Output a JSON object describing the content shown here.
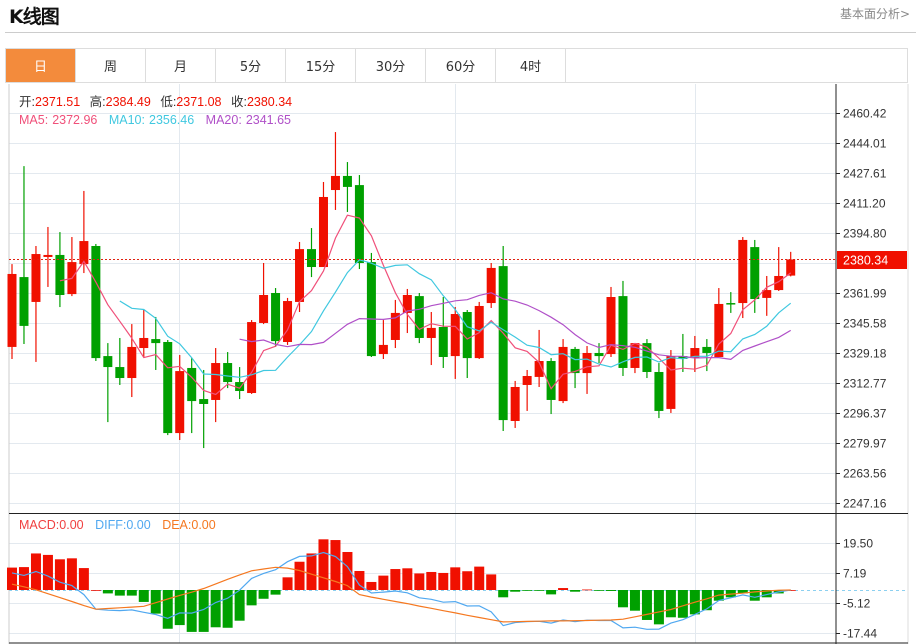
{
  "header": {
    "title": "K线图",
    "fundamentals_link": "基本面分析>"
  },
  "tabs": [
    {
      "label": "日",
      "active": true
    },
    {
      "label": "周"
    },
    {
      "label": "月"
    },
    {
      "label": "5分"
    },
    {
      "label": "15分"
    },
    {
      "label": "30分"
    },
    {
      "label": "60分"
    },
    {
      "label": "4时"
    }
  ],
  "legend": {
    "open_label": "开:",
    "open": "2371.51",
    "high_label": "高:",
    "high": "2384.49",
    "low_label": "低:",
    "low": "2371.08",
    "close_label": "收:",
    "close": "2380.34",
    "ma5_label": "MA5:",
    "ma5": "2372.96",
    "ma10_label": "MA10:",
    "ma10": "2356.46",
    "ma20_label": "MA20:",
    "ma20": "2341.65"
  },
  "macd_legend": {
    "macd_label": "MACD:",
    "macd": "0.00",
    "diff_label": "DIFF:",
    "diff": "0.00",
    "dea_label": "DEA:",
    "dea": "0.00"
  },
  "colors": {
    "up": "#f01000",
    "down": "#00a000",
    "ma5": "#f0507a",
    "ma10": "#40c8e0",
    "ma20": "#b050c8",
    "diff": "#50a8f0",
    "dea": "#f57820",
    "accent": "#f38b3c"
  },
  "chart_data": [
    {
      "type": "candlestick",
      "title": "K线图",
      "price_ticks": [
        "2460.42",
        "2444.01",
        "2427.61",
        "2411.20",
        "2394.80",
        "2361.99",
        "2345.58",
        "2329.18",
        "2312.77",
        "2296.37",
        "2279.97",
        "2263.56",
        "2247.16"
      ],
      "ylim": [
        2247.16,
        2460.42
      ],
      "last_price": "2380.34",
      "ohlc": [
        [
          2332.5,
          2377.8,
          2325.9,
          2372.4
        ],
        [
          2370.7,
          2431.4,
          2334.1,
          2344.0
        ],
        [
          2357.1,
          2387.7,
          2324.3,
          2383.3
        ],
        [
          2381.7,
          2398.1,
          2365.3,
          2382.8
        ],
        [
          2382.8,
          2395.3,
          2354.3,
          2360.9
        ],
        [
          2361.4,
          2392.6,
          2360.3,
          2378.9
        ],
        [
          2377.8,
          2417.8,
          2372.9,
          2390.4
        ],
        [
          2387.7,
          2388.8,
          2324.8,
          2326.4
        ],
        [
          2327.5,
          2334.6,
          2291.4,
          2321.5
        ],
        [
          2321.5,
          2337.4,
          2311.7,
          2315.5
        ],
        [
          2315.5,
          2345.0,
          2305.1,
          2332.5
        ],
        [
          2331.9,
          2352.7,
          2327.0,
          2337.4
        ],
        [
          2336.8,
          2348.9,
          2319.9,
          2334.6
        ],
        [
          2335.2,
          2336.3,
          2284.3,
          2285.4
        ],
        [
          2285.4,
          2328.1,
          2281.6,
          2319.3
        ],
        [
          2321.0,
          2326.4,
          2285.4,
          2302.9
        ],
        [
          2304.0,
          2319.9,
          2277.2,
          2301.3
        ],
        [
          2303.5,
          2331.9,
          2291.4,
          2323.7
        ],
        [
          2323.7,
          2329.7,
          2310.0,
          2313.3
        ],
        [
          2313.3,
          2321.5,
          2304.0,
          2308.4
        ],
        [
          2307.3,
          2347.2,
          2306.8,
          2346.1
        ],
        [
          2345.6,
          2378.4,
          2345.0,
          2360.9
        ],
        [
          2362.0,
          2364.7,
          2332.5,
          2335.7
        ],
        [
          2335.2,
          2359.3,
          2333.6,
          2357.6
        ],
        [
          2357.1,
          2389.9,
          2351.6,
          2386.0
        ],
        [
          2386.0,
          2397.5,
          2370.7,
          2376.2
        ],
        [
          2376.2,
          2422.7,
          2376.2,
          2414.5
        ],
        [
          2418.3,
          2450.0,
          2407.4,
          2426.0
        ],
        [
          2426.0,
          2433.6,
          2406.3,
          2420.0
        ],
        [
          2421.0,
          2426.5,
          2375.1,
          2378.4
        ],
        [
          2378.9,
          2383.9,
          2327.0,
          2327.5
        ],
        [
          2328.6,
          2347.2,
          2325.9,
          2333.6
        ],
        [
          2336.3,
          2358.2,
          2331.9,
          2351.1
        ],
        [
          2351.1,
          2364.2,
          2340.1,
          2360.9
        ],
        [
          2360.3,
          2362.0,
          2334.6,
          2337.4
        ],
        [
          2337.4,
          2351.6,
          2322.6,
          2342.9
        ],
        [
          2343.4,
          2359.8,
          2321.0,
          2327.0
        ],
        [
          2327.5,
          2354.3,
          2315.0,
          2350.5
        ],
        [
          2351.6,
          2352.7,
          2315.5,
          2326.4
        ],
        [
          2326.4,
          2357.1,
          2325.9,
          2354.9
        ],
        [
          2356.5,
          2378.4,
          2353.8,
          2375.7
        ],
        [
          2376.7,
          2387.7,
          2286.5,
          2292.5
        ],
        [
          2292.0,
          2313.9,
          2288.2,
          2310.6
        ],
        [
          2311.7,
          2319.9,
          2297.5,
          2316.6
        ],
        [
          2316.1,
          2341.8,
          2310.6,
          2324.8
        ],
        [
          2324.8,
          2326.4,
          2295.8,
          2303.5
        ],
        [
          2302.9,
          2336.8,
          2301.8,
          2332.5
        ],
        [
          2331.4,
          2332.5,
          2310.0,
          2318.2
        ],
        [
          2318.2,
          2333.0,
          2306.8,
          2329.2
        ],
        [
          2329.2,
          2334.6,
          2323.7,
          2327.5
        ],
        [
          2328.6,
          2365.3,
          2327.0,
          2359.8
        ],
        [
          2360.3,
          2368.6,
          2316.6,
          2321.0
        ],
        [
          2321.0,
          2334.6,
          2318.2,
          2334.6
        ],
        [
          2334.6,
          2336.8,
          2315.5,
          2318.8
        ],
        [
          2318.8,
          2323.7,
          2293.6,
          2297.5
        ],
        [
          2298.6,
          2330.8,
          2296.4,
          2327.5
        ],
        [
          2327.5,
          2339.6,
          2318.8,
          2325.9
        ],
        [
          2326.4,
          2338.5,
          2318.8,
          2331.9
        ],
        [
          2332.5,
          2336.8,
          2319.3,
          2329.2
        ],
        [
          2327.0,
          2364.7,
          2327.0,
          2356.0
        ],
        [
          2356.5,
          2362.5,
          2351.1,
          2356.3
        ],
        [
          2356.5,
          2392.6,
          2348.3,
          2391.0
        ],
        [
          2387.1,
          2391.0,
          2351.1,
          2358.7
        ],
        [
          2359.3,
          2371.3,
          2349.5,
          2363.6
        ],
        [
          2363.6,
          2387.1,
          2363.1,
          2371.3
        ],
        [
          2371.51,
          2384.49,
          2371.08,
          2380.34
        ]
      ],
      "moving_averages": [
        5,
        10,
        20
      ]
    },
    {
      "type": "bar",
      "title": "MACD",
      "y_ticks": [
        "19.50",
        "7.19",
        "-5.12",
        "-17.44"
      ],
      "ylim": [
        -19,
        26
      ],
      "macd": [
        9.2,
        9.4,
        15.0,
        14.4,
        12.6,
        13.0,
        9.0,
        0,
        -1.4,
        -2.3,
        -2.3,
        -4.9,
        -9.7,
        -15.9,
        -14.4,
        -17.2,
        -17.2,
        -15.3,
        -15.5,
        -12.6,
        -6.3,
        -3.6,
        -1.9,
        5.2,
        11.6,
        15.0,
        20.8,
        20.5,
        15.6,
        7.8,
        3.3,
        5.9,
        8.6,
        8.9,
        6.8,
        7.4,
        7.0,
        9.3,
        7.7,
        9.6,
        6.4,
        -3.0,
        -0.7,
        -0.1,
        -0.1,
        -1.8,
        0.8,
        -0.7,
        0.2,
        -0.2,
        -0.4,
        -7.1,
        -8.5,
        -12.3,
        -14.1,
        -11.2,
        -11.4,
        -10.0,
        -8.3,
        -4.4,
        -3.0,
        -1.4,
        -4.4,
        -3.0,
        -1.4,
        0
      ],
      "dea": [
        2.4,
        1.3,
        0.1,
        -1.5,
        -3.1,
        -4.7,
        -6.4,
        -7.9,
        -7.6,
        -7.3,
        -7.0,
        -6.7,
        -5.2,
        -3.7,
        -2.2,
        -0.9,
        0.6,
        2.5,
        4.4,
        6.2,
        7.9,
        8.6,
        9.3,
        9.0,
        8.0,
        6.5,
        5.0,
        3.5,
        1.8,
        -1.9,
        -2.9,
        -3.8,
        -4.7,
        -5.6,
        -6.6,
        -7.5,
        -8.5,
        -9.4,
        -10.4,
        -11.3,
        -12.2,
        -13.1,
        -13.0,
        -12.9,
        -12.8,
        -12.7,
        -12.7,
        -12.6,
        -12.5,
        -12.4,
        -12.3,
        -12.0,
        -11.0,
        -10.0,
        -9.0,
        -8.0,
        -6.5,
        -5.0,
        -3.6,
        -2.1,
        -1.7,
        -1.3,
        -0.8,
        -0.4,
        -0.1,
        0
      ]
    }
  ]
}
